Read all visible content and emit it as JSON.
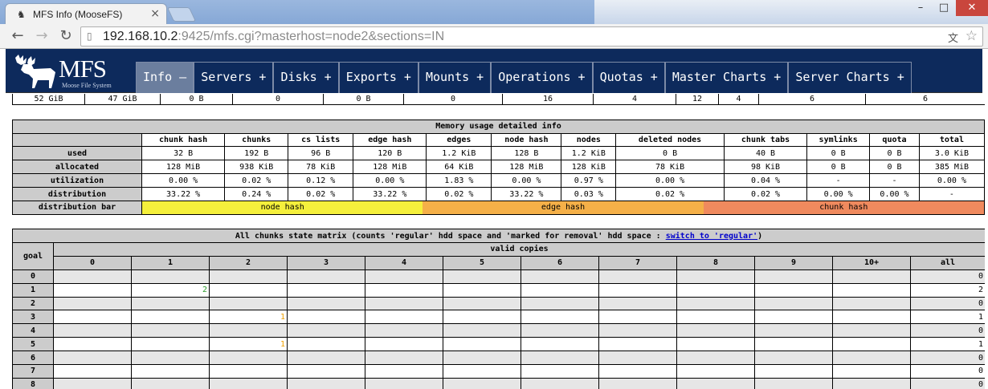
{
  "browser": {
    "tab_title": "MFS Info (MooseFS)",
    "url_host": "192.168.10.2",
    "url_rest": ":9425/mfs.cgi?masterhost=node2&sections=IN"
  },
  "header": {
    "logo_text": "MFS",
    "logo_subtitle": "Moose File System",
    "nav": [
      {
        "label": "Info –",
        "active": true
      },
      {
        "label": "Servers +"
      },
      {
        "label": "Disks +"
      },
      {
        "label": "Exports +"
      },
      {
        "label": "Mounts +"
      },
      {
        "label": "Operations +"
      },
      {
        "label": "Quotas +"
      },
      {
        "label": "Master Charts +"
      },
      {
        "label": "Server Charts +"
      }
    ]
  },
  "top_fragment": [
    "52  GiB",
    "47  GiB",
    "0  B",
    "0",
    "0  B",
    "0",
    "16",
    "4",
    "12",
    "4",
    "6",
    "6"
  ],
  "memory": {
    "title": "Memory usage detailed info",
    "columns": [
      "chunk hash",
      "chunks",
      "cs lists",
      "edge hash",
      "edges",
      "node hash",
      "nodes",
      "deleted nodes",
      "chunk tabs",
      "symlinks",
      "quota",
      "total"
    ],
    "rows": [
      {
        "label": "used",
        "values": [
          "32  B",
          "192  B",
          "96  B",
          "120  B",
          "1.2  KiB",
          "128  B",
          "1.2  KiB",
          "0  B",
          "40  B",
          "0  B",
          "0  B",
          "3.0  KiB"
        ]
      },
      {
        "label": "allocated",
        "values": [
          "128  MiB",
          "938  KiB",
          "78  KiB",
          "128  MiB",
          "64  KiB",
          "128  MiB",
          "128  KiB",
          "78  KiB",
          "98  KiB",
          "0  B",
          "0  B",
          "385  MiB"
        ]
      },
      {
        "label": "utilization",
        "values": [
          "0.00 %",
          "0.02 %",
          "0.12 %",
          "0.00 %",
          "1.83 %",
          "0.00 %",
          "0.97 %",
          "0.00 %",
          "0.04 %",
          "-",
          "-",
          "0.00 %"
        ]
      },
      {
        "label": "distribution",
        "values": [
          "33.22 %",
          "0.24 %",
          "0.02 %",
          "33.22 %",
          "0.02 %",
          "33.22 %",
          "0.03 %",
          "0.02 %",
          "0.02 %",
          "0.00 %",
          "0.00 %",
          "-"
        ]
      }
    ],
    "bar_label": "distribution bar",
    "bar_segments": [
      {
        "label": "node hash",
        "percent": 33.22,
        "color": "#f5f03c"
      },
      {
        "label": "edge hash",
        "percent": 33.22,
        "color": "#f5b048"
      },
      {
        "label": "chunk hash",
        "percent": 33.22,
        "color": "#f08a5e"
      }
    ]
  },
  "matrix": {
    "title_prefix": "All chunks state matrix (counts 'regular' hdd space and 'marked for removal' hdd space : ",
    "title_link": "switch to 'regular'",
    "title_suffix": ")",
    "goal_label": "goal",
    "valid_copies_label": "valid copies",
    "copies": [
      "0",
      "1",
      "2",
      "3",
      "4",
      "5",
      "6",
      "7",
      "8",
      "9",
      "10+",
      "all"
    ],
    "rows": [
      {
        "goal": "0",
        "cells": [
          "",
          "",
          "",
          "",
          "",
          "",
          "",
          "",
          "",
          "",
          "",
          "0"
        ]
      },
      {
        "goal": "1",
        "cells": [
          "",
          "2",
          "",
          "",
          "",
          "",
          "",
          "",
          "",
          "",
          "",
          "2"
        ]
      },
      {
        "goal": "2",
        "cells": [
          "",
          "",
          "",
          "",
          "",
          "",
          "",
          "",
          "",
          "",
          "",
          "0"
        ]
      },
      {
        "goal": "3",
        "cells": [
          "",
          "",
          "1",
          "",
          "",
          "",
          "",
          "",
          "",
          "",
          "",
          "1"
        ]
      },
      {
        "goal": "4",
        "cells": [
          "",
          "",
          "",
          "",
          "",
          "",
          "",
          "",
          "",
          "",
          "",
          "0"
        ]
      },
      {
        "goal": "5",
        "cells": [
          "",
          "",
          "1",
          "",
          "",
          "",
          "",
          "",
          "",
          "",
          "",
          "1"
        ]
      },
      {
        "goal": "6",
        "cells": [
          "",
          "",
          "",
          "",
          "",
          "",
          "",
          "",
          "",
          "",
          "",
          "0"
        ]
      },
      {
        "goal": "7",
        "cells": [
          "",
          "",
          "",
          "",
          "",
          "",
          "",
          "",
          "",
          "",
          "",
          "0"
        ]
      },
      {
        "goal": "8",
        "cells": [
          "",
          "",
          "",
          "",
          "",
          "",
          "",
          "",
          "",
          "",
          "",
          "0"
        ]
      }
    ]
  }
}
